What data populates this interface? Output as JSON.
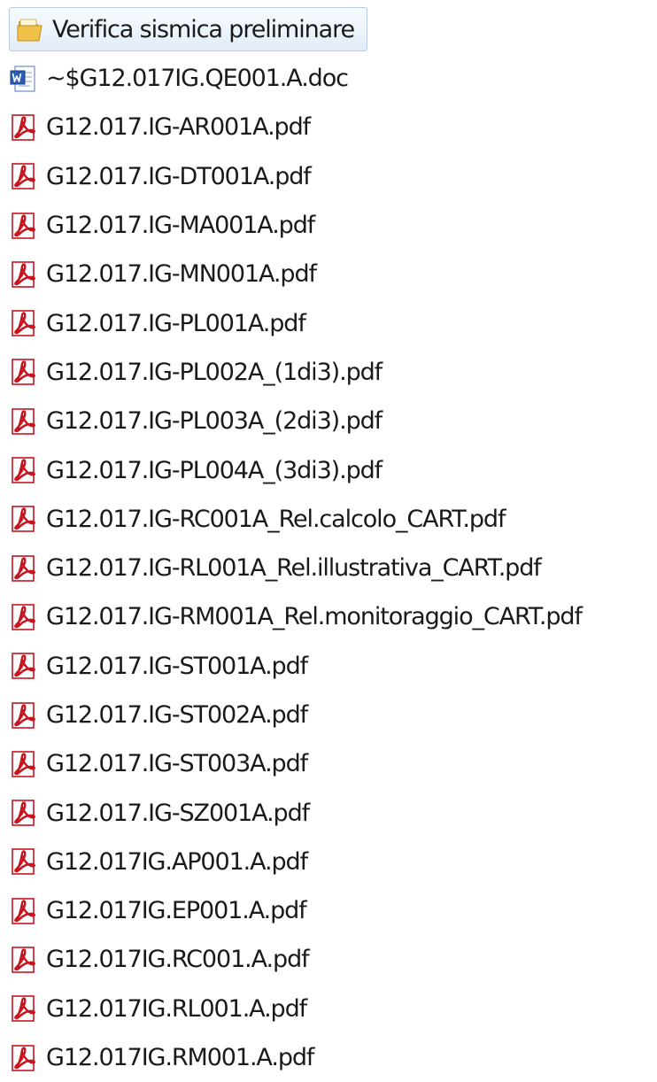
{
  "folder": {
    "name": "Verifica sismica preliminare",
    "icon": "folder-icon"
  },
  "files": [
    {
      "name": "~$G12.017IG.QE001.A.doc",
      "icon": "word-doc-icon"
    },
    {
      "name": "G12.017.IG-AR001A.pdf",
      "icon": "pdf-icon"
    },
    {
      "name": "G12.017.IG-DT001A.pdf",
      "icon": "pdf-icon"
    },
    {
      "name": "G12.017.IG-MA001A.pdf",
      "icon": "pdf-icon"
    },
    {
      "name": "G12.017.IG-MN001A.pdf",
      "icon": "pdf-icon"
    },
    {
      "name": "G12.017.IG-PL001A.pdf",
      "icon": "pdf-icon"
    },
    {
      "name": "G12.017.IG-PL002A_(1di3).pdf",
      "icon": "pdf-icon"
    },
    {
      "name": "G12.017.IG-PL003A_(2di3).pdf",
      "icon": "pdf-icon"
    },
    {
      "name": "G12.017.IG-PL004A_(3di3).pdf",
      "icon": "pdf-icon"
    },
    {
      "name": "G12.017.IG-RC001A_Rel.calcolo_CART.pdf",
      "icon": "pdf-icon"
    },
    {
      "name": "G12.017.IG-RL001A_Rel.illustrativa_CART.pdf",
      "icon": "pdf-icon"
    },
    {
      "name": "G12.017.IG-RM001A_Rel.monitoraggio_CART.pdf",
      "icon": "pdf-icon"
    },
    {
      "name": "G12.017.IG-ST001A.pdf",
      "icon": "pdf-icon"
    },
    {
      "name": "G12.017.IG-ST002A.pdf",
      "icon": "pdf-icon"
    },
    {
      "name": "G12.017.IG-ST003A.pdf",
      "icon": "pdf-icon"
    },
    {
      "name": "G12.017.IG-SZ001A.pdf",
      "icon": "pdf-icon"
    },
    {
      "name": "G12.017IG.AP001.A.pdf",
      "icon": "pdf-icon"
    },
    {
      "name": "G12.017IG.EP001.A.pdf",
      "icon": "pdf-icon"
    },
    {
      "name": "G12.017IG.RC001.A.pdf",
      "icon": "pdf-icon"
    },
    {
      "name": "G12.017IG.RL001.A.pdf",
      "icon": "pdf-icon"
    },
    {
      "name": "G12.017IG.RM001.A.pdf",
      "icon": "pdf-icon"
    }
  ],
  "colors": {
    "pdf_red": "#c8141e",
    "word_blue": "#2a5db0",
    "folder_yellow": "#e8b53a",
    "selection_bg": "#e2ecf7"
  }
}
